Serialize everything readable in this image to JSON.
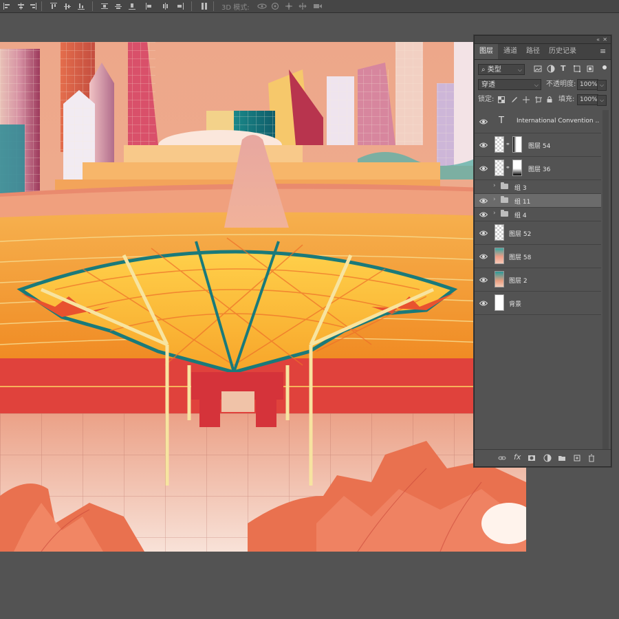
{
  "options_bar": {
    "mode_3d_label": "3D 模式:"
  },
  "layers_panel": {
    "tabs": [
      {
        "label": "图层",
        "active": true
      },
      {
        "label": "通道",
        "active": false
      },
      {
        "label": "路径",
        "active": false
      },
      {
        "label": "历史记录",
        "active": false
      }
    ],
    "filter_kind": "类型",
    "blend_mode": "穿透",
    "opacity_label": "不透明度:",
    "opacity_value": "100%",
    "lock_label": "锁定:",
    "fill_label": "填充:",
    "fill_value": "100%",
    "layers": [
      {
        "type": "text",
        "name": "International Convention ...",
        "visible": true
      },
      {
        "type": "masked",
        "name": "图层 54",
        "visible": true
      },
      {
        "type": "masked",
        "name": "图层 36",
        "visible": true
      },
      {
        "type": "group",
        "name": "组 3",
        "visible": false
      },
      {
        "type": "group",
        "name": "组 11",
        "visible": true,
        "selected": true
      },
      {
        "type": "group",
        "name": "组 4",
        "visible": true
      },
      {
        "type": "pixel",
        "name": "图层 52",
        "visible": true,
        "thumb": "checker"
      },
      {
        "type": "pixel",
        "name": "图层 58",
        "visible": true,
        "thumb": "gradient"
      },
      {
        "type": "pixel",
        "name": "图层 2",
        "visible": true,
        "thumb": "gradient"
      },
      {
        "type": "pixel",
        "name": "背景",
        "visible": true,
        "thumb": "white"
      }
    ],
    "footer_icons": [
      "link-icon",
      "fx-icon",
      "mask-icon",
      "adjustment-icon",
      "folder-icon",
      "new-layer-icon",
      "trash-icon"
    ]
  },
  "colors": {
    "workspace": "#535353",
    "panel": "#535353",
    "selected_row": "#6b6b6b",
    "canvas_sky": "#eda98a"
  }
}
